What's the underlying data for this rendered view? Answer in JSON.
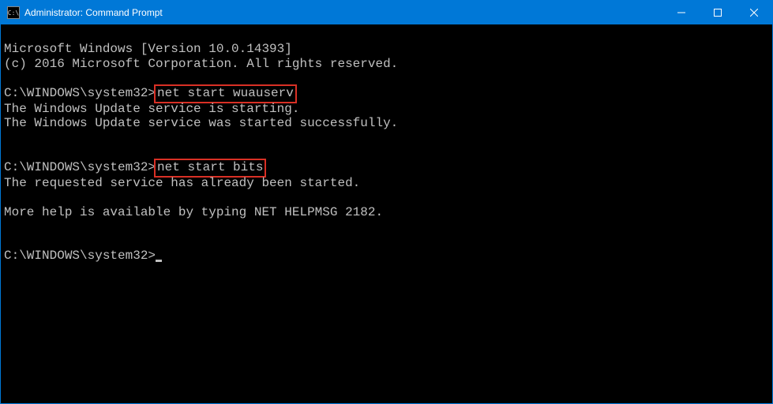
{
  "titlebar": {
    "icon_text": "C:\\",
    "title": "Administrator: Command Prompt"
  },
  "terminal": {
    "banner1": "Microsoft Windows [Version 10.0.14393]",
    "banner2": "(c) 2016 Microsoft Corporation. All rights reserved.",
    "prompt1": "C:\\WINDOWS\\system32>",
    "cmd1": "net start wuauserv",
    "out1a": "The Windows Update service is starting.",
    "out1b": "The Windows Update service was started successfully.",
    "prompt2": "C:\\WINDOWS\\system32>",
    "cmd2": "net start bits",
    "out2a": "The requested service has already been started.",
    "out2b": "More help is available by typing NET HELPMSG 2182.",
    "prompt3": "C:\\WINDOWS\\system32>"
  }
}
